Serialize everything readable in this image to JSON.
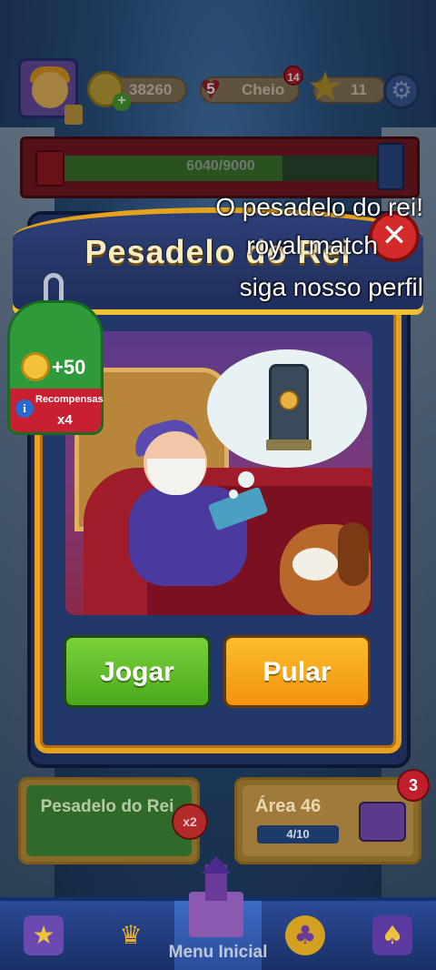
{
  "hud": {
    "coins": "38260",
    "lives": "5",
    "lives_status": "Cheio",
    "lives_notification": "14",
    "stars": "11"
  },
  "progress": {
    "text": "6040/9000",
    "value": 6040,
    "max": 9000
  },
  "modal": {
    "title": "Pesadelo do Rei",
    "close_symbol": "✕",
    "reward": {
      "amount": "+50",
      "label": "Recompensas",
      "multiplier": "x4",
      "info_symbol": "i"
    },
    "play_label": "Jogar",
    "skip_label": "Pular"
  },
  "caption": {
    "line1": "O pesadelo do rei!",
    "line2": "royal match",
    "line3": "siga nosso perfil"
  },
  "cards": {
    "event_label": "Pesadelo do Rei",
    "event_multiplier": "x2",
    "area_label": "Área 46",
    "area_progress": "4/10",
    "area_progress_value": 0.4,
    "area_badge": "3"
  },
  "nav": {
    "home_label": "Menu Inicial",
    "icons": [
      "star-icon",
      "trophy-icon",
      "castle-icon",
      "team-icon",
      "cards-icon"
    ]
  },
  "colors": {
    "play_button": "#4aa81c",
    "skip_button": "#f2930e",
    "close_button": "#d42a2a",
    "frame_gold": "#e6a21c"
  }
}
